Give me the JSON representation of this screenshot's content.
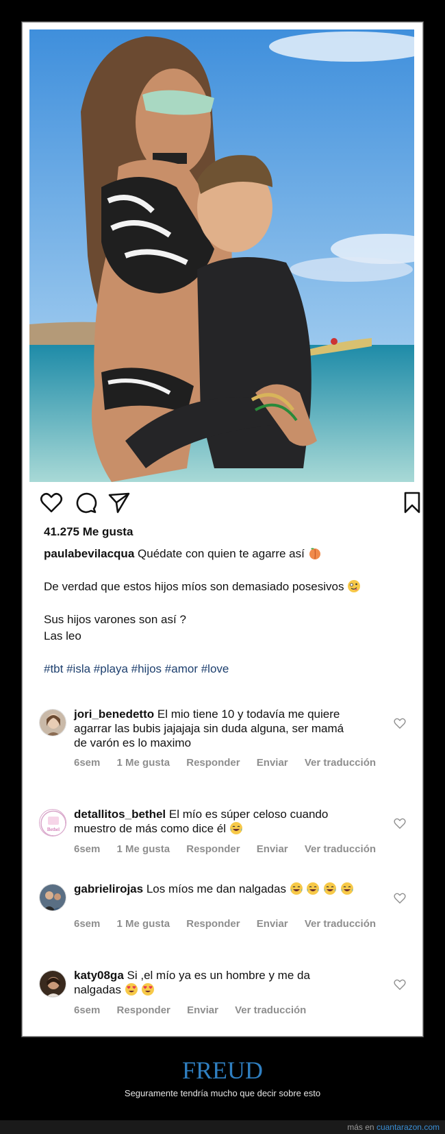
{
  "post": {
    "likes": "41.275 Me gusta",
    "caption_user": "paulabevilacqua",
    "caption_line1": "Quédate con quien te agarre así",
    "caption_line2": "De verdad que estos hijos míos son demasiado posesivos",
    "caption_line3": "Sus hijos varones son así ?",
    "caption_line4": "Las leo",
    "hashtags": [
      "#tbt",
      "#isla",
      "#playa",
      "#hijos",
      "#amor",
      "#love"
    ]
  },
  "comments": [
    {
      "user": "jori_benedetto",
      "text": "El mio tiene 10 y todavía me quiere agarrar las bubis jajajaja sin duda alguna, ser mamá de varón es lo maximo",
      "time": "6sem",
      "likes": "1 Me gusta",
      "reply": "Responder",
      "send": "Enviar",
      "translate": "Ver traducción"
    },
    {
      "user": "detallitos_bethel",
      "text": "El mío es súper celoso cuando muestro de más como dice él",
      "time": "6sem",
      "likes": "1 Me gusta",
      "reply": "Responder",
      "send": "Enviar",
      "translate": "Ver traducción",
      "avatar_text": "Bethel"
    },
    {
      "user": "gabrielirojas",
      "text": "Los míos me dan nalgadas",
      "time": "6sem",
      "likes": "1 Me gusta",
      "reply": "Responder",
      "send": "Enviar",
      "translate": "Ver traducción"
    },
    {
      "user": "katy08ga",
      "text": "Si ,el mío ya es un hombre y me da nalgadas",
      "time": "6sem",
      "reply": "Responder",
      "send": "Enviar",
      "translate": "Ver traducción"
    }
  ],
  "icons": [
    "heart-icon",
    "comment-icon",
    "share-icon",
    "bookmark-icon"
  ],
  "footer": {
    "title": "FREUD",
    "subtitle": "Seguramente tendría mucho que decir sobre esto",
    "source_prefix": "más en",
    "source_link": "cuantarazon.com"
  },
  "colors": {
    "hashtag": "#1d3f6e",
    "meta_gray": "#8e8e8e",
    "footer_title": "#2f7fc1",
    "link": "#3a8fd6"
  }
}
